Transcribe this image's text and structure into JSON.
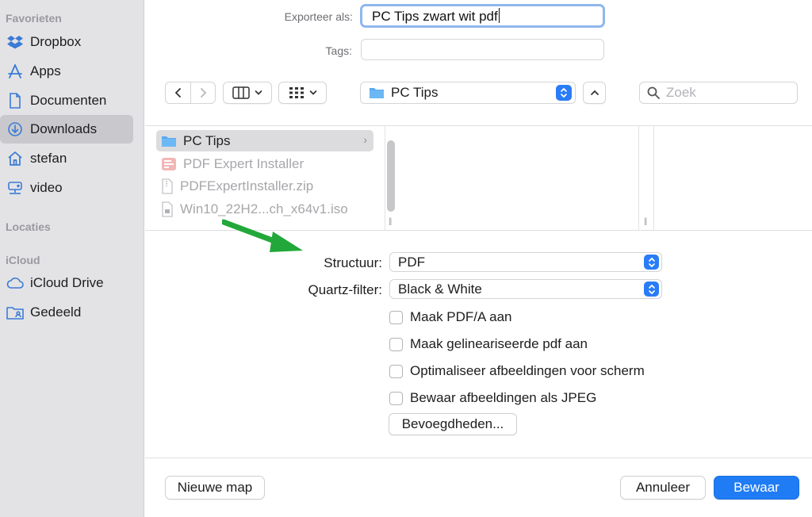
{
  "sidebar": {
    "sections": {
      "favorites": "Favorieten",
      "locations": "Locaties",
      "icloud": "iCloud"
    },
    "items": [
      {
        "label": "Dropbox",
        "icon": "dropbox-icon"
      },
      {
        "label": "Apps",
        "icon": "apps-icon"
      },
      {
        "label": "Documenten",
        "icon": "document-icon"
      },
      {
        "label": "Downloads",
        "icon": "download-icon",
        "selected": true
      },
      {
        "label": "stefan",
        "icon": "home-icon"
      },
      {
        "label": "video",
        "icon": "network-drive-icon"
      }
    ],
    "icloud_items": [
      {
        "label": "iCloud Drive",
        "icon": "cloud-icon"
      },
      {
        "label": "Gedeeld",
        "icon": "shared-folder-icon"
      }
    ]
  },
  "export": {
    "label": "Exporteer als:",
    "value": "PC Tips zwart wit pdf"
  },
  "tags": {
    "label": "Tags:",
    "value": ""
  },
  "toolbar": {
    "location": "PC Tips",
    "search_placeholder": "Zoek"
  },
  "files": [
    {
      "name": "PC Tips",
      "type": "folder",
      "selected": true
    },
    {
      "name": "PDF Expert Installer",
      "type": "app",
      "dimmed": true
    },
    {
      "name": "PDFExpertInstaller.zip",
      "type": "zip",
      "dimmed": true
    },
    {
      "name": "Win10_22H2...ch_x64v1.iso",
      "type": "iso",
      "dimmed": true
    }
  ],
  "options": {
    "structure": {
      "label": "Structuur:",
      "value": "PDF"
    },
    "quartz": {
      "label": "Quartz-filter:",
      "value": "Black & White"
    },
    "checkboxes": [
      {
        "label": "Maak PDF/A aan",
        "checked": false
      },
      {
        "label": "Maak gelineariseerde pdf aan",
        "checked": false
      },
      {
        "label": "Optimaliseer afbeeldingen voor scherm",
        "checked": false
      },
      {
        "label": "Bewaar afbeeldingen als JPEG",
        "checked": false
      }
    ],
    "permissions_button": "Bevoegdheden..."
  },
  "buttons": {
    "new_folder": "Nieuwe map",
    "cancel": "Annuleer",
    "save": "Bewaar"
  },
  "colors": {
    "accent": "#1f7cf5",
    "sidebar_bg": "#e3e3e6",
    "annotation_arrow": "#22a83a"
  }
}
